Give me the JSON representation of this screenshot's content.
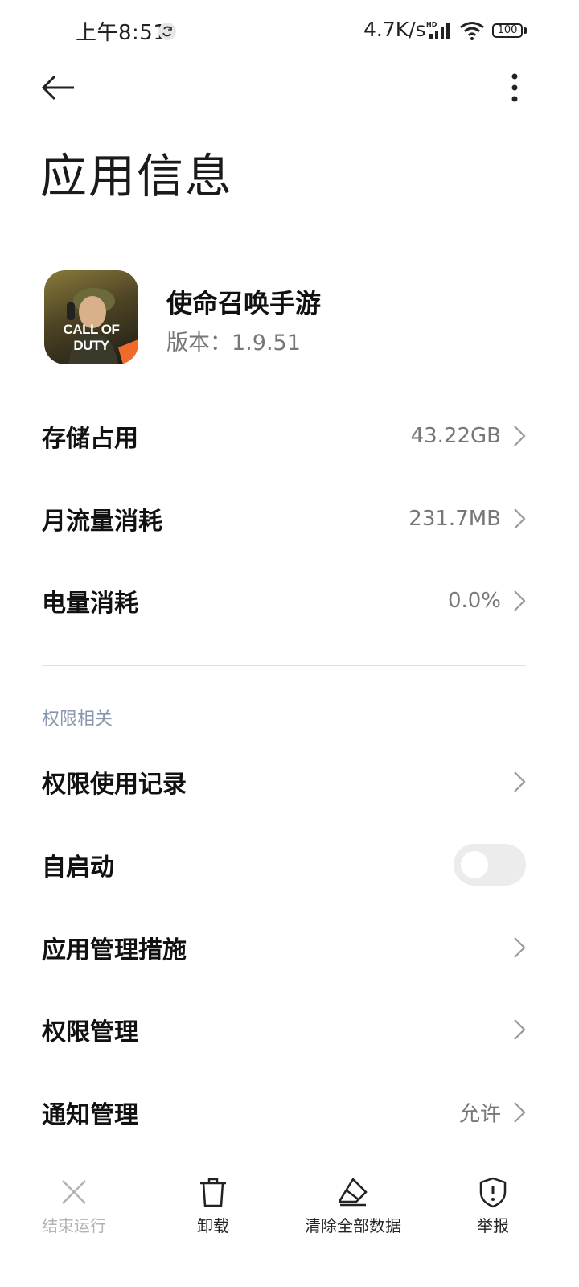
{
  "status_bar": {
    "time": "上午8:51",
    "net_speed": "4.7K/s",
    "signal_badge": "HD",
    "battery": "100"
  },
  "header": {
    "title": "应用信息",
    "back_icon": "arrow-left-icon",
    "more_icon": "more-vertical-icon"
  },
  "app": {
    "name": "使命召唤手游",
    "version": "版本：1.9.51",
    "icon_text": "CALL OF DUTY"
  },
  "usage_rows": [
    {
      "label": "存储占用",
      "value": "43.22GB"
    },
    {
      "label": "月流量消耗",
      "value": "231.7MB"
    },
    {
      "label": "电量消耗",
      "value": "0.0%"
    }
  ],
  "permissions": {
    "section_title": "权限相关",
    "rows": [
      {
        "label": "权限使用记录",
        "value": ""
      },
      {
        "label": "自启动",
        "toggle_on": false
      },
      {
        "label": "应用管理措施",
        "value": ""
      },
      {
        "label": "权限管理",
        "value": ""
      },
      {
        "label": "通知管理",
        "value": "允许"
      }
    ]
  },
  "actions": [
    {
      "label": "结束运行",
      "icon": "close-icon",
      "enabled": false
    },
    {
      "label": "卸载",
      "icon": "trash-icon",
      "enabled": true
    },
    {
      "label": "清除全部数据",
      "icon": "eraser-icon",
      "enabled": true
    },
    {
      "label": "举报",
      "icon": "shield-alert-icon",
      "enabled": true
    }
  ],
  "colors": {
    "section_header": "#8a96ad",
    "secondary_text": "#777777",
    "disabled_text": "#b3b3b3",
    "toggle_off": "#ececec"
  }
}
